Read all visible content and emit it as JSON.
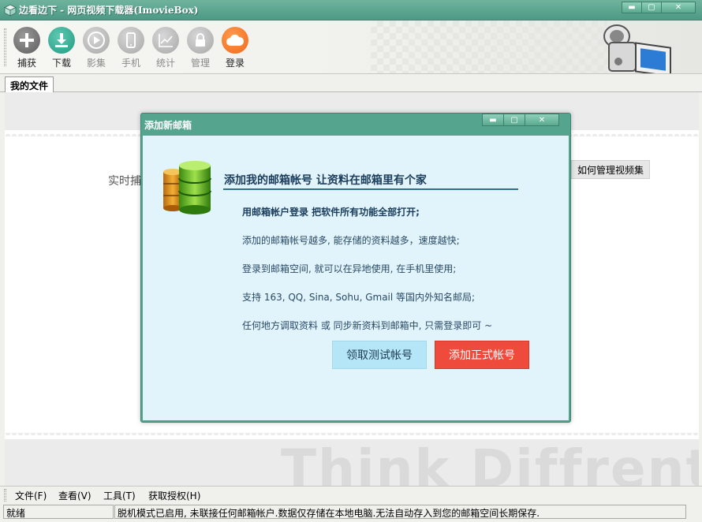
{
  "window": {
    "title": "边看边下 - 网页视频下载器(ImovieBox)",
    "min_symbol": "▬",
    "max_symbol": "▢",
    "close_symbol": "✕"
  },
  "toolbar": {
    "buttons": [
      {
        "label": "捕获",
        "icon": "plus-icon",
        "enabled": true
      },
      {
        "label": "下载",
        "icon": "download-icon",
        "enabled": true
      },
      {
        "label": "影集",
        "icon": "play-icon",
        "enabled": false
      },
      {
        "label": "手机",
        "icon": "phone-icon",
        "enabled": false
      },
      {
        "label": "统计",
        "icon": "chart-icon",
        "enabled": false
      },
      {
        "label": "管理",
        "icon": "lock-icon",
        "enabled": false
      },
      {
        "label": "登录",
        "icon": "cloud-icon",
        "enabled": true
      }
    ]
  },
  "tabs": [
    {
      "label": "我的文件",
      "active": true
    }
  ],
  "main": {
    "hint_text": "实时捕",
    "manage_button": "如何管理视频集",
    "watermark": "Think Diffrent"
  },
  "menu": {
    "items": [
      "文件(F)",
      "查看(V)",
      "工具(T)",
      "获取授权(H)"
    ]
  },
  "status": {
    "state": "就绪",
    "message": "脱机模式已启用, 未联接任何邮箱帐户.数据仅存储在本地电脑.无法自动存入到您的邮箱空间长期保存."
  },
  "dialog": {
    "title": "添加新邮箱",
    "min_symbol": "▬",
    "max_symbol": "▢",
    "close_symbol": "✕",
    "heading": "添加我的邮箱帐号 让资料在邮箱里有个家",
    "subheading": "用邮箱帐户登录 把软件所有功能全部打开;",
    "lines": [
      "添加的邮箱帐号越多, 能存储的资料越多，速度越快;",
      "登录到邮箱空间, 就可以在异地使用, 在手机里使用;",
      "支持 163, QQ, Sina, Sohu, Gmail 等国内外知名邮局;",
      "任何地方调取资料 或 同步新资料到邮箱中, 只需登录即可 ~"
    ],
    "test_button": "领取测试帐号",
    "real_button": "添加正式帐号"
  },
  "colors": {
    "titlebar": "#55a58e",
    "dialog_body": "#e1f4fb",
    "primary_button": "#ee4b3d",
    "secondary_button": "#b5e6f7"
  }
}
